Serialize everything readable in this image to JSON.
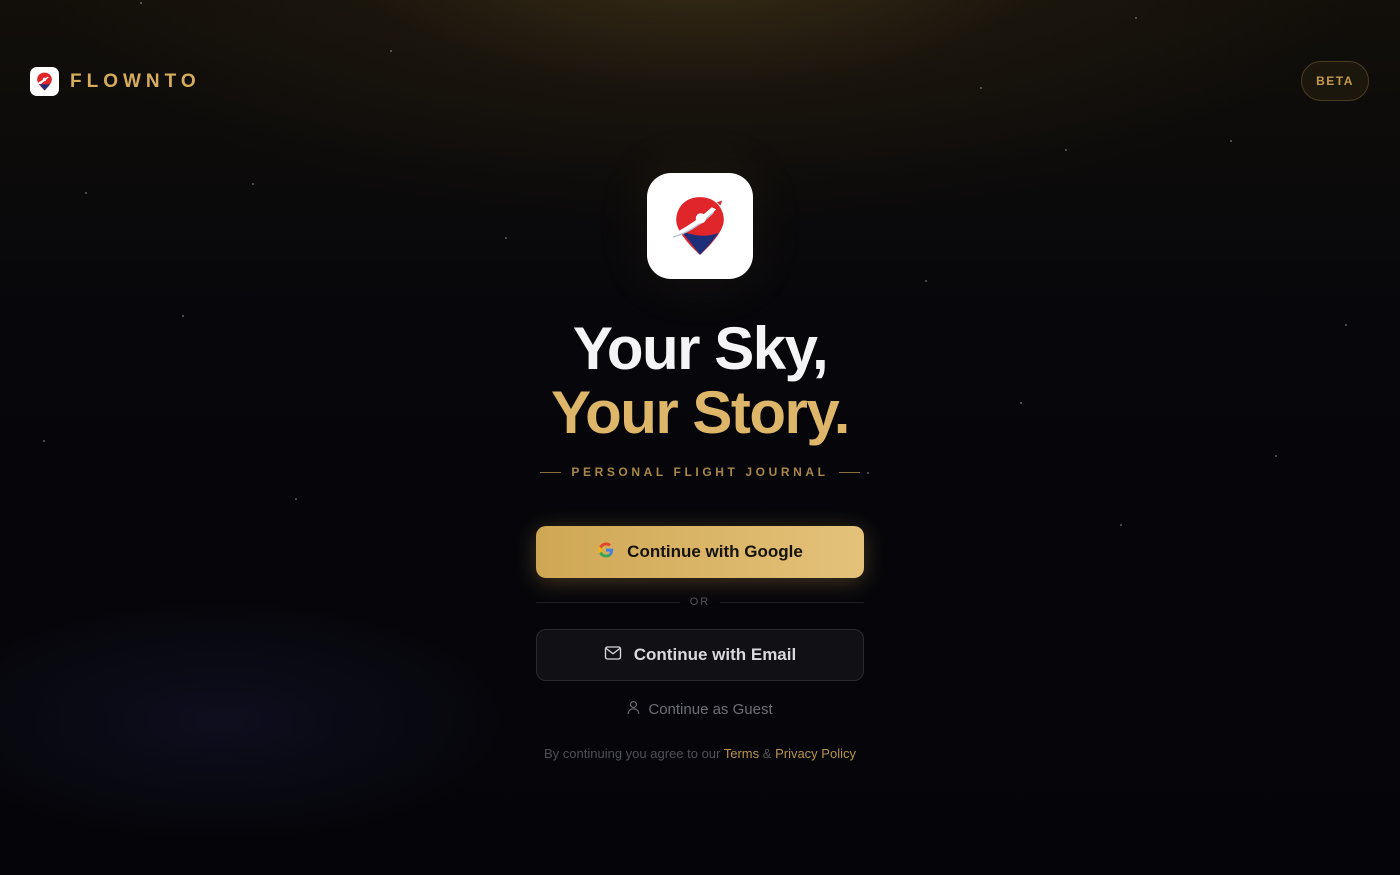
{
  "header": {
    "brand_name": "FLOWNTO",
    "badge": "BETA"
  },
  "hero": {
    "headline_line1": "Your Sky,",
    "headline_line2": "Your Story.",
    "tagline": "PERSONAL FLIGHT JOURNAL"
  },
  "auth": {
    "google_label": "Continue with Google",
    "divider_label": "OR",
    "email_label": "Continue with Email",
    "guest_label": "Continue as Guest"
  },
  "legal": {
    "prefix": "By continuing you agree to our",
    "terms_label": "Terms",
    "joiner": "&",
    "privacy_label": "Privacy Policy"
  },
  "colors": {
    "accent_gold": "#d6ad5c",
    "background": "#05050a",
    "logo_red": "#e0252b",
    "logo_navy": "#1e2f7a"
  },
  "icons": {
    "brand_logo": "map-pin-plane-icon",
    "google": "google-icon",
    "email": "mail-icon",
    "guest": "user-icon"
  }
}
